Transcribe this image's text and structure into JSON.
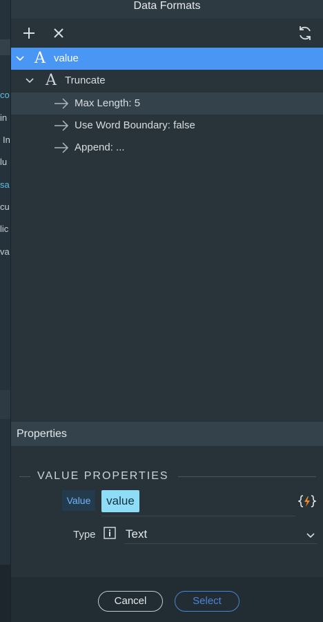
{
  "background_panel": {
    "fragments": [
      "co",
      "in",
      "In",
      "lu",
      "sa",
      "cu",
      "lic",
      "va"
    ]
  },
  "dialog": {
    "title": "Data Formats",
    "toolbar": {
      "add_icon": "plus-icon",
      "remove_icon": "close-icon",
      "refresh_icon": "refresh-icon"
    },
    "tree": [
      {
        "label": "value",
        "kind": "root",
        "selected": true
      },
      {
        "label": "Truncate",
        "kind": "format"
      },
      {
        "label": "Max Length: 5",
        "kind": "param",
        "hover": true
      },
      {
        "label": "Use Word Boundary: false",
        "kind": "param"
      },
      {
        "label": "Append: ...",
        "kind": "param"
      }
    ],
    "properties": {
      "header": "Properties",
      "section_title": "VALUE PROPERTIES",
      "value_label": "Value",
      "value": "value",
      "type_label": "Type",
      "type_value": "Text"
    },
    "buttons": {
      "cancel": "Cancel",
      "select": "Select"
    }
  },
  "colors": {
    "selected_row": "#4a96f4",
    "value_chip": "#8fdcf6",
    "accent_orange": "#f08a24",
    "select_button": "#4a86d9"
  }
}
